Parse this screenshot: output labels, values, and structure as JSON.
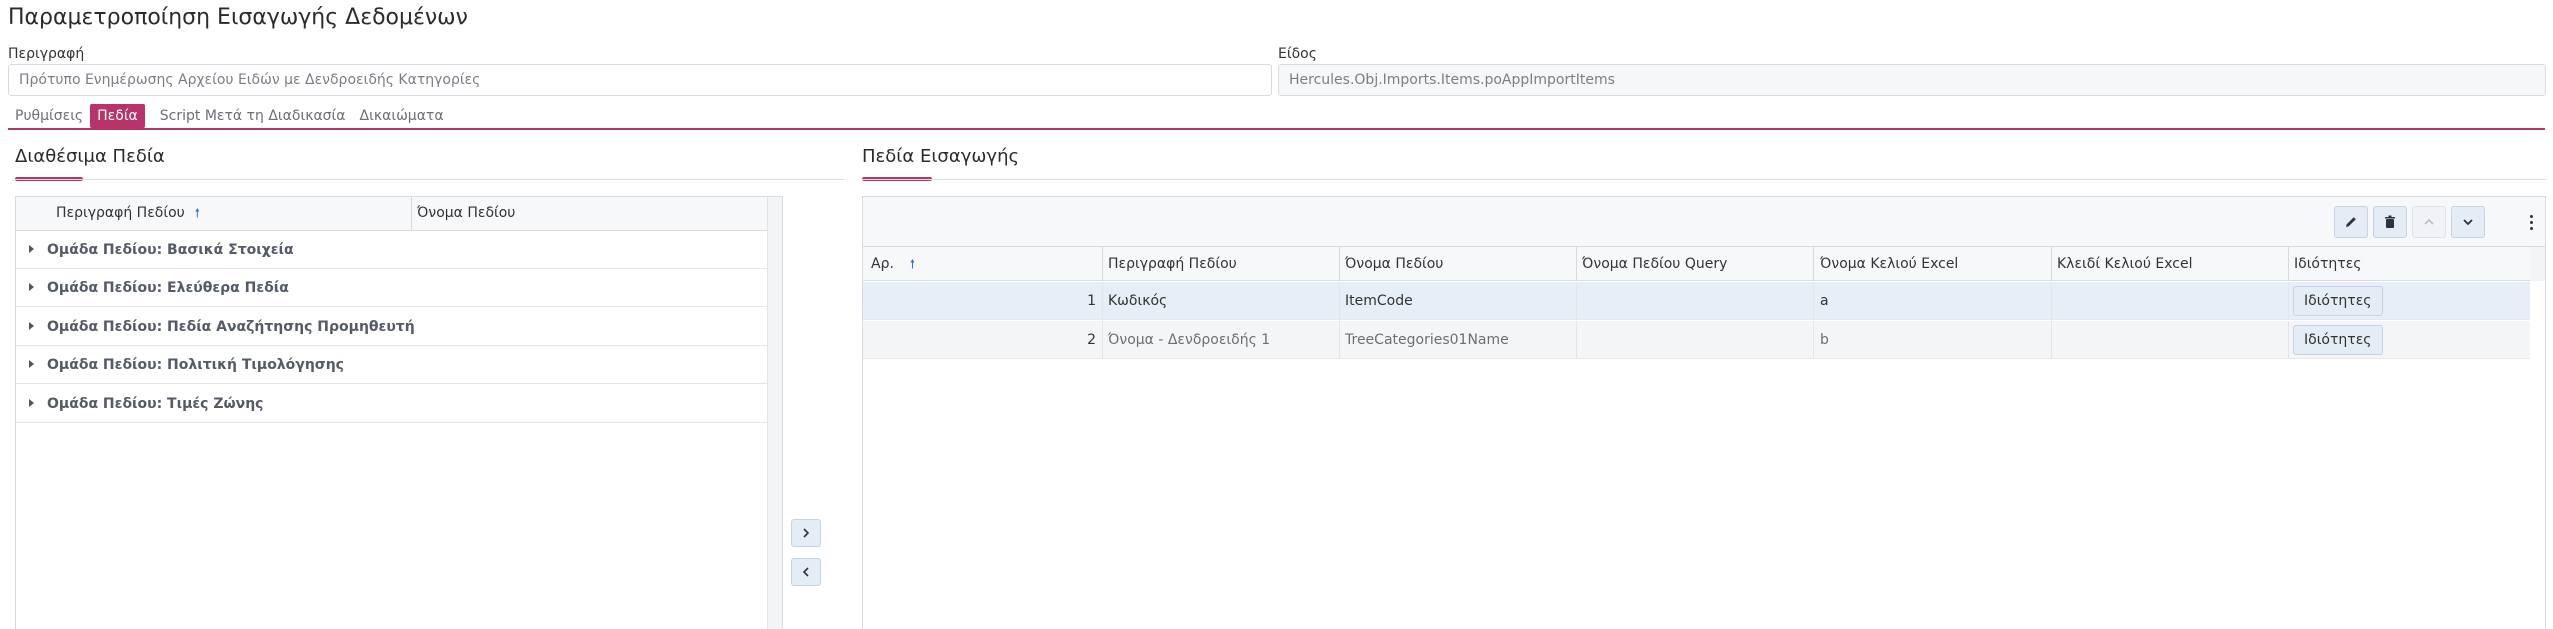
{
  "page": {
    "title": "Παραμετροποίηση Εισαγωγής Δεδομένων"
  },
  "form": {
    "description_label": "Περιγραφή",
    "description_value": "Πρότυπο Ενημέρωσης Αρχείου Ειδών με Δενδροειδής Κατηγορίες",
    "type_label": "Είδος",
    "type_value": "Hercules.Obj.Imports.Items.poAppImportItems"
  },
  "tabs": [
    {
      "label": "Ρυθμίσεις",
      "active": false
    },
    {
      "label": "Πεδία",
      "active": true
    },
    {
      "label": "Script Μετά τη Διαδικασία",
      "active": false
    },
    {
      "label": "Δικαιώματα",
      "active": false
    }
  ],
  "available_fields": {
    "title": "Διαθέσιμα Πεδία",
    "columns": [
      "Περιγραφή Πεδίου",
      "Όνομα Πεδίου"
    ],
    "sort_icon": "arrow-up-icon",
    "groups": [
      "Ομάδα Πεδίου: Βασικά Στοιχεία",
      "Ομάδα Πεδίου: Ελεύθερα Πεδία",
      "Ομάδα Πεδίου: Πεδία Αναζήτησης Προμηθευτή",
      "Ομάδα Πεδίου: Πολιτική Τιμολόγησης",
      "Ομάδα Πεδίου: Τιμές Ζώνης"
    ]
  },
  "move_buttons": {
    "add_icon": "chevron-right-icon",
    "remove_icon": "chevron-left-icon"
  },
  "import_fields": {
    "title": "Πεδία Εισαγωγής",
    "toolbar": [
      "edit-icon",
      "trash-icon",
      "chevron-up-icon",
      "chevron-down-icon",
      "more-vertical-icon"
    ],
    "columns": [
      "Αρ.",
      "Περιγραφή Πεδίου",
      "Όνομα Πεδίου",
      "Όνομα Πεδίου Query",
      "Όνομα Κελιού Excel",
      "Κλειδί Κελιού Excel",
      "Ιδιότητες"
    ],
    "rows": [
      {
        "no": "1",
        "description": "Κωδικός",
        "name": "ItemCode",
        "query": "",
        "excel_cell": "a",
        "excel_key": "",
        "props": "Ιδιότητες"
      },
      {
        "no": "2",
        "description": "Όνομα - Δενδροειδής 1",
        "name": "TreeCategories01Name",
        "query": "",
        "excel_cell": "b",
        "excel_key": "",
        "props": "Ιδιότητες"
      }
    ]
  },
  "colors": {
    "accent": "#b8336a",
    "link": "#2e6bd6",
    "selected_row": "#e7eef8"
  }
}
